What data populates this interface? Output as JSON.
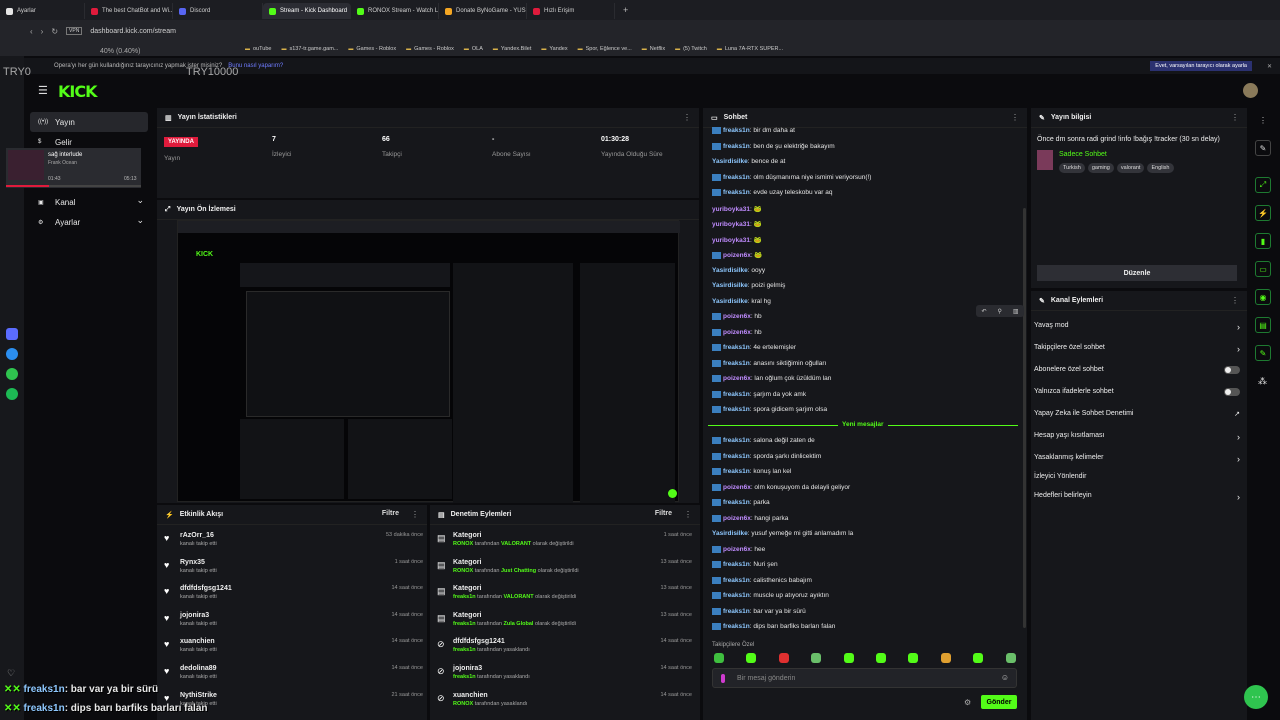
{
  "browser": {
    "tabs": [
      {
        "label": "Ayarlar",
        "color": "#e4e4e4"
      },
      {
        "label": "The best ChatBot and Wi...",
        "color": "#e01b3c"
      },
      {
        "label": "Discord",
        "color": "#5865f2"
      },
      {
        "label": "Stream - Kick Dashboard",
        "color": "#53fc18",
        "active": true
      },
      {
        "label": "RONOX Stream - Watch Li...",
        "color": "#53fc18"
      },
      {
        "label": "Donate ByNoGame - YUS...",
        "color": "#f4a623"
      },
      {
        "label": "Hızlı Erişim",
        "color": "#e01b3c"
      }
    ],
    "url": "dashboard.kick.com/stream",
    "vpn": "VPN",
    "bookmarks": [
      "ouTube",
      "s137-tr.game.gam...",
      "Games - Roblox",
      "Games - Roblox",
      "OLA",
      "Yandex.Bilet",
      "Yandex",
      "Spor, Eğlence ve...",
      "Netflix",
      "(5) Twitch",
      "Luna 7A-RTX SUPER..."
    ],
    "opera_prompt": "Opera'yı her gün kullandığınız tarayıcınız yapmak ister misiniz?",
    "opera_link": "Bunu nasıl yaparım?",
    "opera_btn": "Evet, varsayılan tarayıcı olarak ayarla",
    "overlay_label": "40% (0.40%)",
    "overlay_left": "TRY0",
    "overlay_mid": "TRY10000"
  },
  "sidebar": {
    "items": [
      "Yayın",
      "Gelir",
      "Kanal",
      "Ayarlar"
    ],
    "mini_title": "sağ interlude",
    "mini_sub": "Frank Ocean",
    "mini_time_a": "01:43",
    "mini_time_b": "05:13"
  },
  "stats": {
    "title": "Yayın İstatistikleri",
    "live": "YAYINDA",
    "live_label": "Yayın",
    "viewers": "7",
    "viewers_label": "İzleyici",
    "followers": "66",
    "followers_label": "Takipçi",
    "subs": "-",
    "subs_label": "Abone Sayısı",
    "uptime": "01:30:28",
    "uptime_label": "Yayında Olduğu Süre"
  },
  "preview": {
    "title": "Yayın Ön İzlemesi"
  },
  "activity": {
    "title": "Etkinlik Akışı",
    "filter": "Filtre",
    "items": [
      {
        "name": "rAzOrr_16",
        "sub": "kanalı takip etti",
        "time": "53 dakika önce"
      },
      {
        "name": "Rynx35",
        "sub": "kanalı takip etti",
        "time": "1 saat önce"
      },
      {
        "name": "dfdfdsfgsg1241",
        "sub": "kanalı takip etti",
        "time": "14 saat önce"
      },
      {
        "name": "jojonira3",
        "sub": "kanalı takip etti",
        "time": "14 saat önce"
      },
      {
        "name": "xuanchien",
        "sub": "kanalı takip etti",
        "time": "14 saat önce"
      },
      {
        "name": "dedolina89",
        "sub": "kanalı takip etti",
        "time": "14 saat önce"
      },
      {
        "name": "NythiStrike",
        "sub": "kanalı takip etti",
        "time": "21 saat önce"
      }
    ]
  },
  "moderation": {
    "title": "Denetim Eylemleri",
    "filter": "Filtre",
    "items": [
      {
        "title": "Kategori",
        "who": "RONOX",
        "mid": " tarafından ",
        "what": "VALORANT",
        "end": " olarak değiştirildi",
        "time": "1 saat önce"
      },
      {
        "title": "Kategori",
        "who": "RONOX",
        "mid": " tarafından ",
        "what": "Just Chatting",
        "end": " olarak değiştirildi",
        "time": "13 saat önce"
      },
      {
        "title": "Kategori",
        "who": "freaks1n",
        "mid": " tarafından ",
        "what": "VALORANT",
        "end": " olarak değiştirildi",
        "time": "13 saat önce"
      },
      {
        "title": "Kategori",
        "who": "freaks1n",
        "mid": " tarafından ",
        "what": "Zula Global",
        "end": " olarak değiştirildi",
        "time": "13 saat önce"
      },
      {
        "title": "dfdfdsfgsg1241",
        "who": "freaks1n",
        "mid": " tarafından yasaklandı",
        "what": "",
        "end": "",
        "time": "14 saat önce"
      },
      {
        "title": "jojonira3",
        "who": "freaks1n",
        "mid": " tarafından yasaklandı",
        "what": "",
        "end": "",
        "time": "14 saat önce"
      },
      {
        "title": "xuanchien",
        "who": "RONOX",
        "mid": " tarafından yasaklandı",
        "what": "",
        "end": "",
        "time": "14 saat önce"
      }
    ]
  },
  "chat": {
    "title": "Sohbet",
    "new_messages": "Yeni mesajlar",
    "followers_only": "Takipçilere Özel",
    "placeholder": "Bir mesaj gönderin",
    "send": "Gönder",
    "messages": [
      {
        "user": "freaks1n",
        "text": ": bir dm daha at",
        "color": "#8ec8ff",
        "badge": true
      },
      {
        "user": "freaks1n",
        "text": ": ben de şu elektriğe bakayım",
        "color": "#8ec8ff",
        "badge": true
      },
      {
        "user": "Yasirdisilke",
        "text": ": bence de at",
        "color": "#8ec8ff",
        "badge": false
      },
      {
        "user": "freaks1n",
        "text": ": olm düşmanıma niye ismimi veriyorsun(!)",
        "color": "#8ec8ff",
        "badge": true
      },
      {
        "user": "freaks1n",
        "text": ": evde uzay teleskobu var aq",
        "color": "#8ec8ff",
        "badge": true
      },
      {
        "user": "yuriboyka31",
        "text": ": 🐸",
        "color": "#c08cff",
        "badge": false
      },
      {
        "user": "yuriboyka31",
        "text": ": 🐸",
        "color": "#c08cff",
        "badge": false
      },
      {
        "user": "yuriboyka31",
        "text": ": 🐸",
        "color": "#c08cff",
        "badge": false
      },
      {
        "user": "poizen6x",
        "text": ": 🐸",
        "color": "#c08cff",
        "badge": true
      },
      {
        "user": "Yasirdisilke",
        "text": ": ooyy",
        "color": "#8ec8ff",
        "badge": false
      },
      {
        "user": "Yasirdisilke",
        "text": ": poizi gelmiş",
        "color": "#8ec8ff",
        "badge": false
      },
      {
        "user": "Yasirdisilke",
        "text": ": kral hg",
        "color": "#8ec8ff",
        "badge": false
      },
      {
        "user": "poizen6x",
        "text": ": hb",
        "color": "#c08cff",
        "badge": true
      },
      {
        "user": "poizen6x",
        "text": ": hb",
        "color": "#c08cff",
        "badge": true
      },
      {
        "user": "freaks1n",
        "text": ": 4e ertelemişler",
        "color": "#8ec8ff",
        "badge": true
      },
      {
        "user": "freaks1n",
        "text": ": anasını siktiğimin oğulları",
        "color": "#8ec8ff",
        "badge": true
      },
      {
        "user": "poizen6x",
        "text": ": lan oğlum çok üzüldüm lan",
        "color": "#c08cff",
        "badge": true
      },
      {
        "user": "freaks1n",
        "text": ": şarjım da yok amk",
        "color": "#8ec8ff",
        "badge": true
      },
      {
        "user": "freaks1n",
        "text": ": spora gidicem şarjım olsa",
        "color": "#8ec8ff",
        "badge": true
      },
      {
        "user": "freaks1n",
        "text": ": salona değil zaten de",
        "color": "#8ec8ff",
        "badge": true
      },
      {
        "user": "freaks1n",
        "text": ": sporda şarkı dinlicektim",
        "color": "#8ec8ff",
        "badge": true
      },
      {
        "user": "freaks1n",
        "text": ": konuş lan kel",
        "color": "#8ec8ff",
        "badge": true
      },
      {
        "user": "poizen6x",
        "text": ": olm konuşuyom da delayli geliyor",
        "color": "#c08cff",
        "badge": true
      },
      {
        "user": "freaks1n",
        "text": ": parka",
        "color": "#8ec8ff",
        "badge": true
      },
      {
        "user": "poizen6x",
        "text": ": hangi parka",
        "color": "#c08cff",
        "badge": true
      },
      {
        "user": "Yasirdisilke",
        "text": ": yusuf yemeğe mi gitti anlamadım la",
        "color": "#8ec8ff",
        "badge": false
      },
      {
        "user": "poizen6x",
        "text": ": hee",
        "color": "#c08cff",
        "badge": true
      },
      {
        "user": "freaks1n",
        "text": ": Nuri şen",
        "color": "#8ec8ff",
        "badge": true
      },
      {
        "user": "freaks1n",
        "text": ": calisthenics babajım",
        "color": "#8ec8ff",
        "badge": true
      },
      {
        "user": "freaks1n",
        "text": ": muscle up atıyoruz ayıktın",
        "color": "#8ec8ff",
        "badge": true
      },
      {
        "user": "freaks1n",
        "text": ": bar var ya bir sürü",
        "color": "#8ec8ff",
        "badge": true
      },
      {
        "user": "freaks1n",
        "text": ": dips barı barfiks barları falan",
        "color": "#8ec8ff",
        "badge": true
      }
    ]
  },
  "stream_info": {
    "title": "Yayın bilgisi",
    "stream_title": "Önce dm sonra radi grind !info !bağış !tracker (30 sn delay)",
    "category": "Sadece Sohbet",
    "tags": [
      "Turkish",
      "gaming",
      "valorant",
      "English"
    ],
    "edit": "Düzenle"
  },
  "channel_actions": {
    "title": "Kanal Eylemleri",
    "items": [
      {
        "label": "Yavaş mod",
        "kind": "chevron"
      },
      {
        "label": "Takipçilere özel sohbet",
        "kind": "chevron"
      },
      {
        "label": "Abonelere özel sohbet",
        "kind": "toggle"
      },
      {
        "label": "Yalnızca ifadelerle sohbet",
        "kind": "toggle"
      },
      {
        "label": "Yapay Zeka ile Sohbet Denetimi",
        "kind": "ext"
      },
      {
        "label": "Hesap yaşı kısıtlaması",
        "kind": "chevron"
      },
      {
        "label": "Yasaklanmış kelimeler",
        "kind": "chevron"
      },
      {
        "label": "İzleyici Yönlendir",
        "kind": "none"
      },
      {
        "label": "Hedefleri belirleyin",
        "kind": "chevron"
      }
    ]
  },
  "overlay_chat": [
    {
      "user": "freaks1n",
      "text": ": bar var ya bir sürü"
    },
    {
      "user": "freaks1n",
      "text": ": dips barı barfiks barları falan"
    }
  ],
  "colors": {
    "accent": "#53fc18",
    "panel": "#16171b",
    "bg": "#0b0b0e",
    "live": "#e01b3c"
  }
}
